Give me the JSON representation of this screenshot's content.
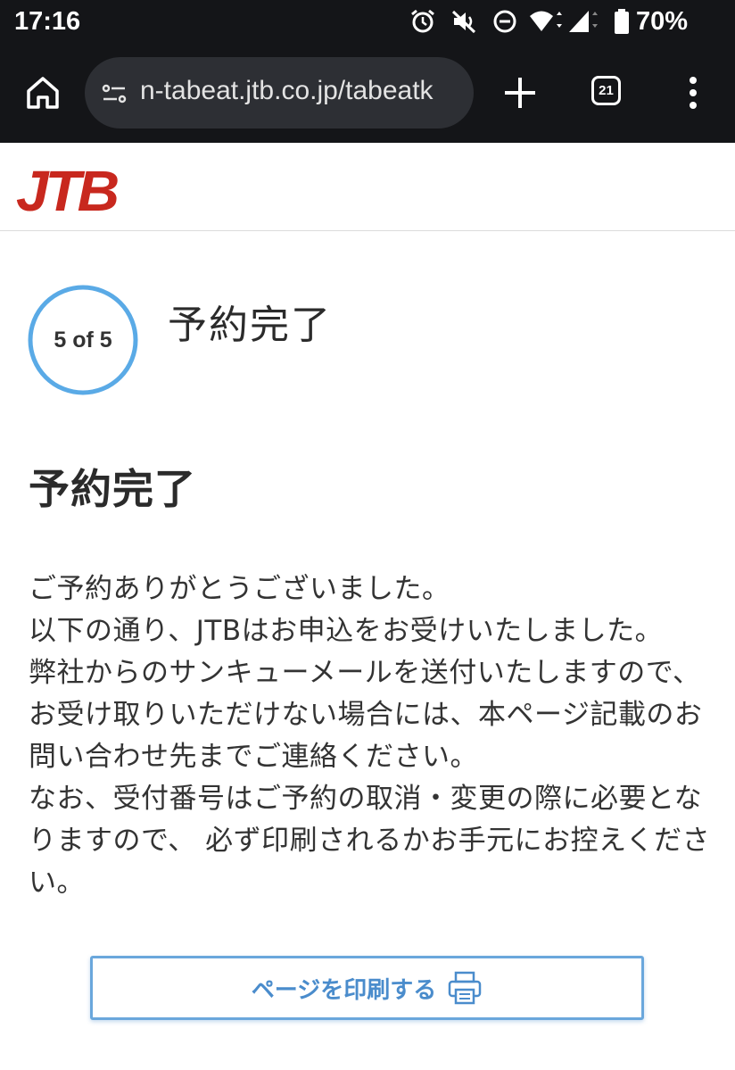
{
  "status_bar": {
    "time": "17:16",
    "battery": "70%",
    "icons": [
      "alarm-icon",
      "mute-icon",
      "do-not-disturb-icon",
      "wifi-icon",
      "signal-icon",
      "battery-icon"
    ]
  },
  "browser": {
    "url": "n-tabeat.jtb.co.jp/tabeatk",
    "tab_count": "21",
    "icons": [
      "home-icon",
      "site-info-icon",
      "plus-icon",
      "tab-switcher-icon",
      "more-vert-icon"
    ]
  },
  "header": {
    "logo_text": "JTB",
    "brand_color": "#c8281e"
  },
  "step": {
    "label": "5 of 5",
    "current": 5,
    "total": 5,
    "title": "予約完了",
    "ring_color": "#5aaae6"
  },
  "content": {
    "heading": "予約完了",
    "message_lines": [
      "ご予約ありがとうございました。",
      "以下の通り、JTBはお申込をお受けいたしました。",
      "弊社からのサンキューメールを送付いたしますので、",
      "お受け取りいただけない場合には、本ページ記載のお",
      "問い合わせ先までご連絡ください。",
      "なお、受付番号はご予約の取消・変更の際に必要とな",
      "りますので、 必ず印刷されるかお手元にお控えくださ",
      "い。"
    ]
  },
  "print_button": {
    "label": "ページを印刷する",
    "icon": "printer-icon",
    "color": "#4a8ccc"
  }
}
